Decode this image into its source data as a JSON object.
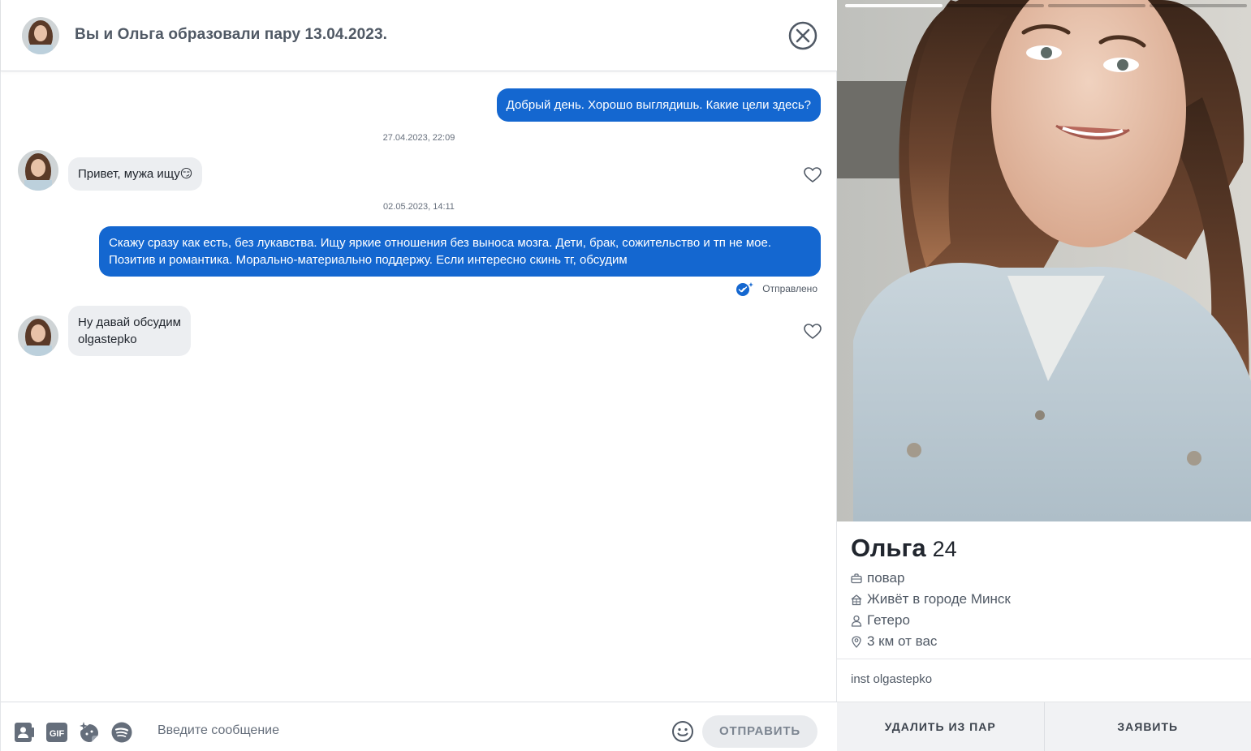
{
  "header": {
    "title": "Вы и Ольга образовали пару 13.04.2023."
  },
  "messages": {
    "out1": "Добрый день. Хорошо выглядишь. Какие цели здесь?",
    "time1": "27.04.2023, 22:09",
    "in1": "Привет, мужа ищу😏",
    "time2": "02.05.2023, 14:11",
    "out2_line1": "Скажу сразу как есть, без лукавства. Ищу яркие отношения без выноса мозга. Дети, брак, сожительство и тп не мое.",
    "out2_line2": "Позитив и романтика. Морально-материально поддержу. Если интересно скинь тг, обсудим",
    "sent_status": "Отправлено",
    "in2_line1": "Ну давай обсудим",
    "in2_line2": "olgastepko"
  },
  "composer": {
    "placeholder": "Введите сообщение",
    "gif_label": "GIF",
    "send_label": "ОТПРАВИТЬ"
  },
  "profile": {
    "name": "Ольга",
    "age": "24",
    "job": "повар",
    "city": "Живёт в городе Минск",
    "orientation": "Гетеро",
    "distance": "3 км от вас",
    "bio": "inst olgastepko",
    "photo_count": 4,
    "active_photo": 1,
    "remove_label": "УДАЛИТЬ ИЗ ПАР",
    "report_label": "ЗАЯВИТЬ"
  },
  "colors": {
    "accent": "#1467d0",
    "incoming_bubble": "#eceef1",
    "text": "#21262e",
    "muted": "#656e7b"
  }
}
